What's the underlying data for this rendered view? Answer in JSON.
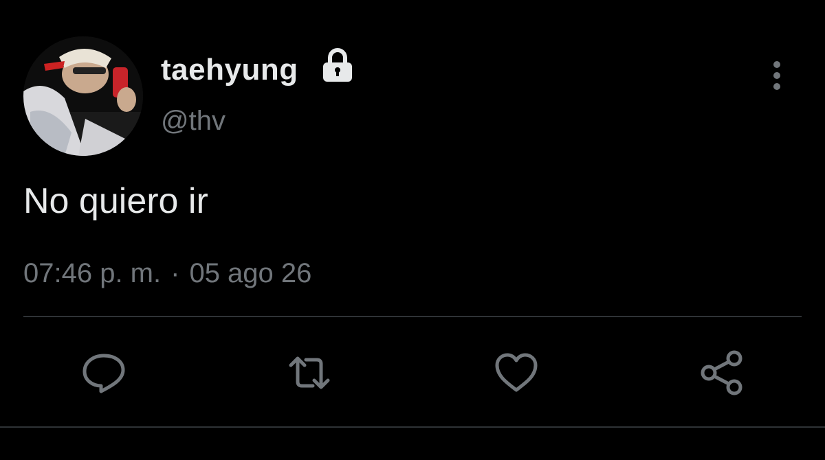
{
  "author": {
    "display_name": "taehyung",
    "handle": "@thv",
    "avatar_icon": "profile-photo",
    "protected_icon": "lock-icon"
  },
  "tweet": {
    "text": "No quiero ir",
    "time": "07:46 p. m.",
    "separator": "·",
    "date": "05 ago 26"
  },
  "actions": {
    "reply_icon": "reply-icon",
    "retweet_icon": "retweet-icon",
    "like_icon": "heart-icon",
    "share_icon": "share-icon"
  },
  "colors": {
    "background": "#000000",
    "primary_text": "#e7e9ea",
    "secondary_text": "#71767b",
    "divider": "#2f3336"
  }
}
